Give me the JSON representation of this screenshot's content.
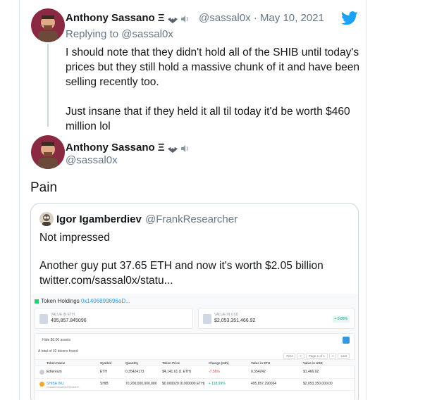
{
  "tweet1": {
    "author_name": "Anthony Sassano Ξ",
    "handle": "@sassal0x",
    "separator": "·",
    "date": "May 10, 2021",
    "replying_to_label": "Replying to",
    "replying_to_handle": "@sassal0x",
    "paragraph1": "I should note that they didn't hold all of the SHIB until today's prices but they still hold a massive chunk of it and have been selling recently too.",
    "paragraph2": "Just insane that if they held it all til today it'd be worth $460 million lol"
  },
  "tweet2": {
    "author_name": "Anthony Sassano Ξ",
    "handle": "@sassal0x",
    "text": "Pain"
  },
  "quoted_tweet": {
    "author_name": "Igor Igamberdiev",
    "handle": "@FrankResearcher",
    "paragraph1": "Not impressed",
    "paragraph2_line1": "Another guy put 37.65 ETH and now it's worth $2.05 billion",
    "paragraph2_line2": "twitter.com/sassal0x/statu..."
  },
  "embedded_screenshot": {
    "title": "Token Holdings",
    "address": "0x1406899696aD...",
    "eth_label": "VALUE IN ETH",
    "eth_value": "495,857.845096",
    "usd_label": "VALUE IN USD",
    "usd_value": "$2,053,351,466.92",
    "change_badge": "+ 0.85%",
    "hide_label": "Hide $0.00 assets",
    "total_label": "A total of 32 tokens found",
    "pager": [
      "First",
      "<",
      "Page 1 of 1",
      ">",
      "Last"
    ],
    "columns": [
      "Token Name",
      "Symbol",
      "Quantity",
      "Token Price",
      "Change (24h)",
      "Value in ETH",
      "Value in USD"
    ],
    "rows": [
      {
        "name": "Ethereum",
        "symbol": "ETH",
        "quantity": "0.35424173",
        "price": "$4,141.61 (1 ETH)",
        "change": "-7.56%",
        "value_eth": "0.354242",
        "value_usd": "$1,466.92"
      },
      {
        "name": "SHIBA INU",
        "sub": "0x95aD61b0a150d79219dCF...",
        "symbol": "SHIB",
        "quantity": "70,200,000,000,000",
        "price": "$0.000029 (0.000000 ETH)",
        "change": "+ 118.99%",
        "value_eth": "495,857.290064",
        "value_usd": "$2,053,350,000.00"
      }
    ]
  },
  "colors": {
    "twitter_blue": "#1da1f2",
    "text_primary": "#14171a",
    "text_secondary": "#657786",
    "border": "#ccd6dd"
  },
  "icons": [
    "avatar-image",
    "twitter-bird-icon",
    "bat-emoji-icon",
    "speaker-emoji-icon"
  ]
}
